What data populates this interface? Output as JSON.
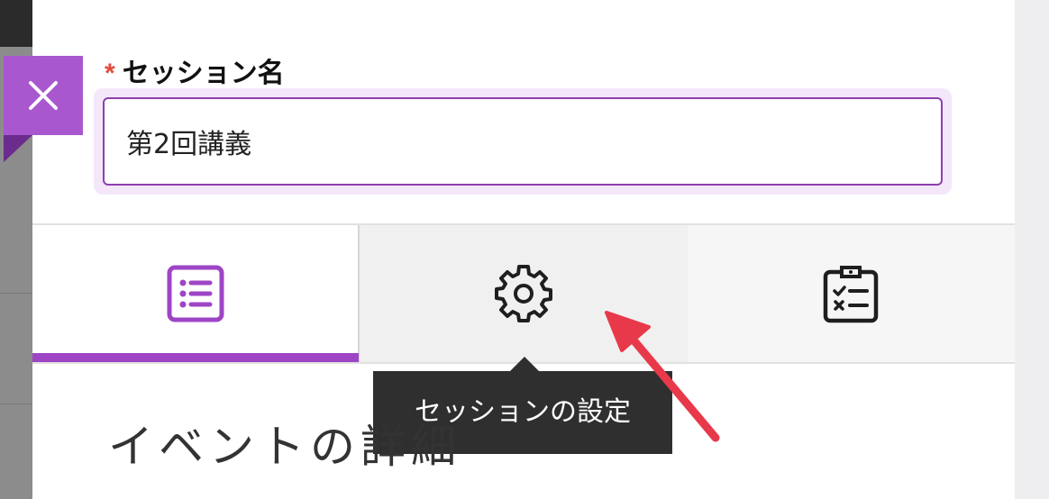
{
  "form": {
    "required_mark": "*",
    "session_name_label": "セッション名",
    "session_name_value": "第2回講義"
  },
  "tabs": [
    {
      "icon": "list-icon",
      "selected": true
    },
    {
      "icon": "gear-icon",
      "selected": false,
      "hovered": true
    },
    {
      "icon": "clipboard-checklist-icon",
      "selected": false
    }
  ],
  "tooltip": {
    "text": "セッションの設定"
  },
  "section": {
    "heading": "イベントの詳細"
  },
  "colors": {
    "accent": "#9e45c6",
    "close_button": "#a857cf",
    "required": "#e24a3b",
    "annotation_arrow": "#e8394a"
  }
}
